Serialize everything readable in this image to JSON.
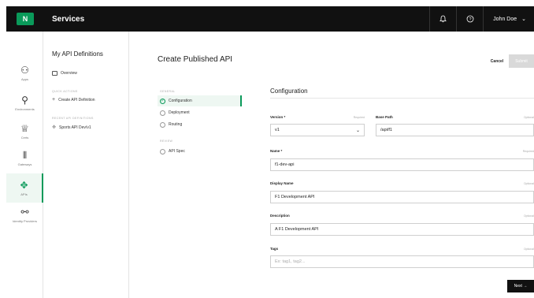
{
  "topbar": {
    "logo_letter": "N",
    "title": "Services",
    "bell_icon": "bell-icon",
    "help_icon": "help-icon",
    "user_name": "John Doe"
  },
  "rail": [
    {
      "label": "Apps",
      "icon": "apps-icon"
    },
    {
      "label": "Environments",
      "icon": "environments-icon"
    },
    {
      "label": "Certs",
      "icon": "certs-icon"
    },
    {
      "label": "Gateways",
      "icon": "gateways-icon"
    },
    {
      "label": "APIs",
      "icon": "apis-icon",
      "active": true
    },
    {
      "label": "Identity Providers",
      "icon": "identity-providers-icon"
    }
  ],
  "sidebar": {
    "title": "My API Definitions",
    "overview": "Overview",
    "quick_actions_label": "QUICK ACTIONS",
    "create_action": "Create API Definition",
    "recent_label": "RECENT API DEFINITIONS",
    "recent_item": "Sports API Dev/v1"
  },
  "main": {
    "title": "Create Published API",
    "cancel": "Cancel",
    "submit": "Submit",
    "steps_general_label": "GENERAL",
    "steps_review_label": "REVIEW",
    "steps": [
      "Configuration",
      "Deployment",
      "Routing"
    ],
    "review_step": "API Spec",
    "form_title": "Configuration",
    "version_label": "Version *",
    "version_req": "Required",
    "version_value": "v1",
    "basepath_label": "Base Path",
    "basepath_opt": "Optional",
    "basepath_value": "/api/f1",
    "name_label": "Name *",
    "name_req": "Required",
    "name_value": "f1-dev-api",
    "display_label": "Display Name",
    "display_opt": "Optional",
    "display_value": "F1 Development API",
    "desc_label": "Description",
    "desc_opt": "Optional",
    "desc_value": "A F1 Development API",
    "tags_label": "Tags",
    "tags_opt": "Optional",
    "tags_placeholder": "Ex: tag1, tag2...",
    "next": "Next →"
  },
  "colors": {
    "accent": "#0a9a5a",
    "topbar": "#111111"
  }
}
